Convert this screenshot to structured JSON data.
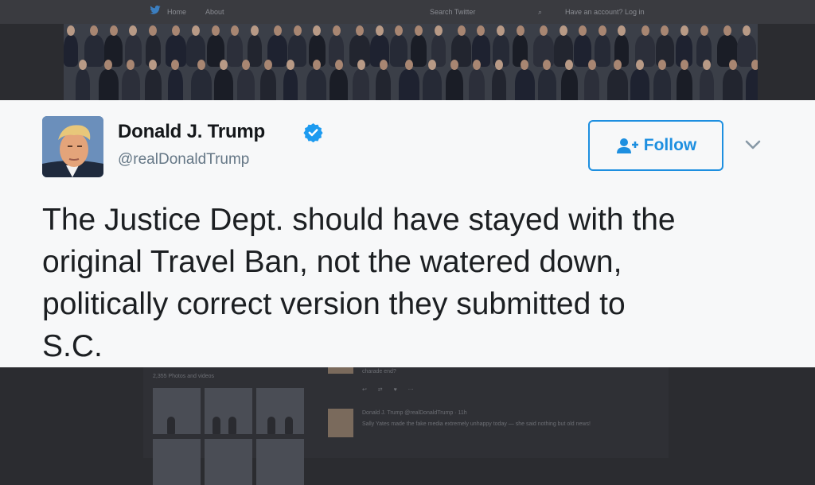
{
  "background": {
    "topbar": {
      "home_label": "Home",
      "about_label": "About",
      "search_placeholder": "Search Twitter",
      "login_label": "Have an account? Log in"
    },
    "photos_label": "2,355 Photos and videos",
    "prev_tweet_fragment": "charade end?",
    "tweet2_header": "Donald J. Trump @realDonaldTrump · 11h",
    "tweet2_text": "Sally Yates made the fake media extremely unhappy today — she said nothing but old news!"
  },
  "tweet": {
    "display_name": "Donald J. Trump",
    "handle": "@realDonaldTrump",
    "verified": true,
    "follow_label": "Follow",
    "text": "The Justice Dept. should have stayed with the\noriginal Travel Ban, not the watered down,\npolitically correct version they submitted to\nS.C."
  },
  "icons": {
    "follow": "add-user-icon",
    "menu": "chevron-down-icon",
    "verified": "verified-badge-icon"
  },
  "colors": {
    "accent": "#1d8fe0",
    "card_bg": "#f7f8f9",
    "text": "#1c1f22",
    "secondary": "#657786"
  }
}
